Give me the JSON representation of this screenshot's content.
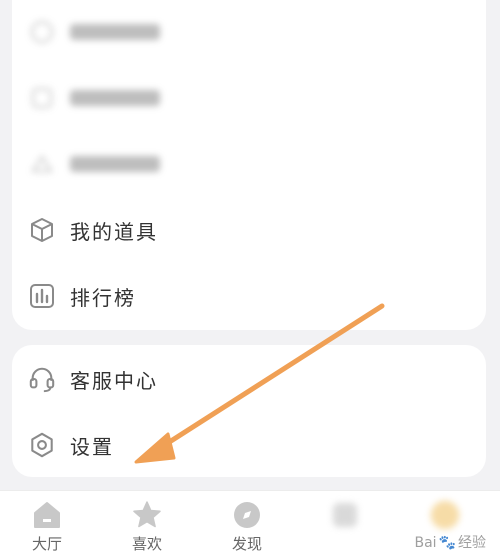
{
  "menu_card": {
    "items": [
      {
        "label": "我的道具",
        "icon": "box-icon"
      },
      {
        "label": "排行榜",
        "icon": "bar-chart-icon"
      }
    ]
  },
  "service_card": {
    "items": [
      {
        "label": "客服中心",
        "icon": "headset-icon"
      },
      {
        "label": "设置",
        "icon": "settings-icon"
      }
    ]
  },
  "tabbar": {
    "tabs": [
      {
        "label": "大厅",
        "icon": "home-icon"
      },
      {
        "label": "喜欢",
        "icon": "star-icon"
      },
      {
        "label": "发现",
        "icon": "compass-icon"
      }
    ]
  },
  "colors": {
    "annotation_arrow": "#f0a055",
    "background": "#f2f2f4",
    "card": "#ffffff"
  },
  "watermark": {
    "text_left": "Bai",
    "text_right": "经验"
  }
}
